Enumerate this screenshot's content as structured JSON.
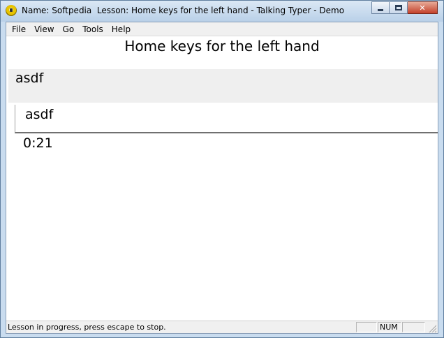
{
  "window": {
    "title": "Name: Softpedia  Lesson: Home keys for the left hand - Talking Typer - Demo",
    "controls": {
      "minimize": "",
      "maximize": "",
      "close": "✕"
    }
  },
  "menu": {
    "items": [
      "File",
      "View",
      "Go",
      "Tools",
      "Help"
    ]
  },
  "lesson": {
    "title": "Home keys for the left hand",
    "target_text": "asdf",
    "typed_text": "asdf",
    "timer": "0:21"
  },
  "statusbar": {
    "message": "Lesson in progress, press escape to stop.",
    "panes": [
      "",
      "NUM",
      ""
    ]
  },
  "icons": {
    "app": "talking-typer-app-icon",
    "grip": "resize-grip-icon"
  }
}
